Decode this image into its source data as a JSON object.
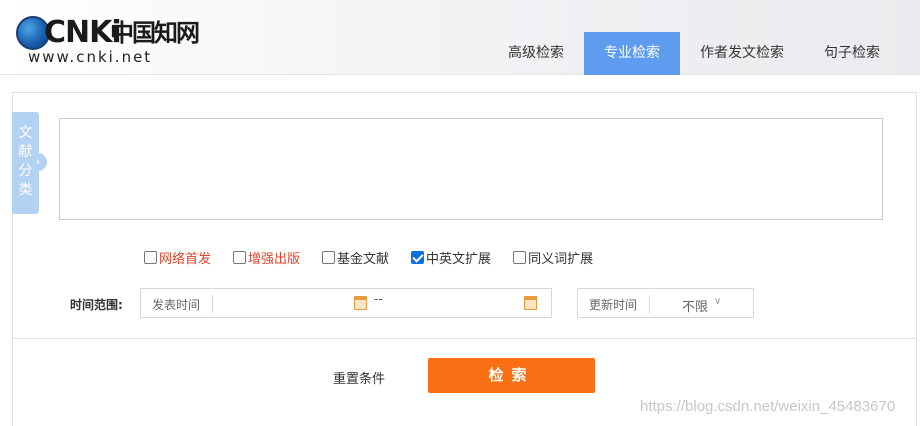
{
  "logo": {
    "brand": "CNKi",
    "chinese": "中国知网",
    "url": "www.cnki.net"
  },
  "tabs": [
    {
      "label": "高级检索",
      "active": false
    },
    {
      "label": "专业检索",
      "active": true
    },
    {
      "label": "作者发文检索",
      "active": false
    },
    {
      "label": "句子检索",
      "active": false
    }
  ],
  "side_tab": {
    "chars": [
      "文",
      "献",
      "分",
      "类"
    ],
    "arrow": "›"
  },
  "query": {
    "value": ""
  },
  "options": [
    {
      "label": "网络首发",
      "checked": false,
      "color": "#e0442a"
    },
    {
      "label": "增强出版",
      "checked": false,
      "color": "#e0442a"
    },
    {
      "label": "基金文献",
      "checked": false
    },
    {
      "label": "中英文扩展",
      "checked": true
    },
    {
      "label": "同义词扩展",
      "checked": false
    }
  ],
  "time": {
    "label": "时间范围:",
    "publish_label": "发表时间",
    "range_separator": "--",
    "update_label": "更新时间",
    "update_value": "不限",
    "update_chevron": "∨"
  },
  "actions": {
    "reset_label": "重置条件",
    "search_label": "检索"
  },
  "watermark": "https://blog.csdn.net/weixin_45483670",
  "colors": {
    "active_tab": "#5e9cf0",
    "search_button": "#fa6f13",
    "side_tab": "#b3d2f3",
    "checkbox_checked": "#0b6fe2"
  }
}
